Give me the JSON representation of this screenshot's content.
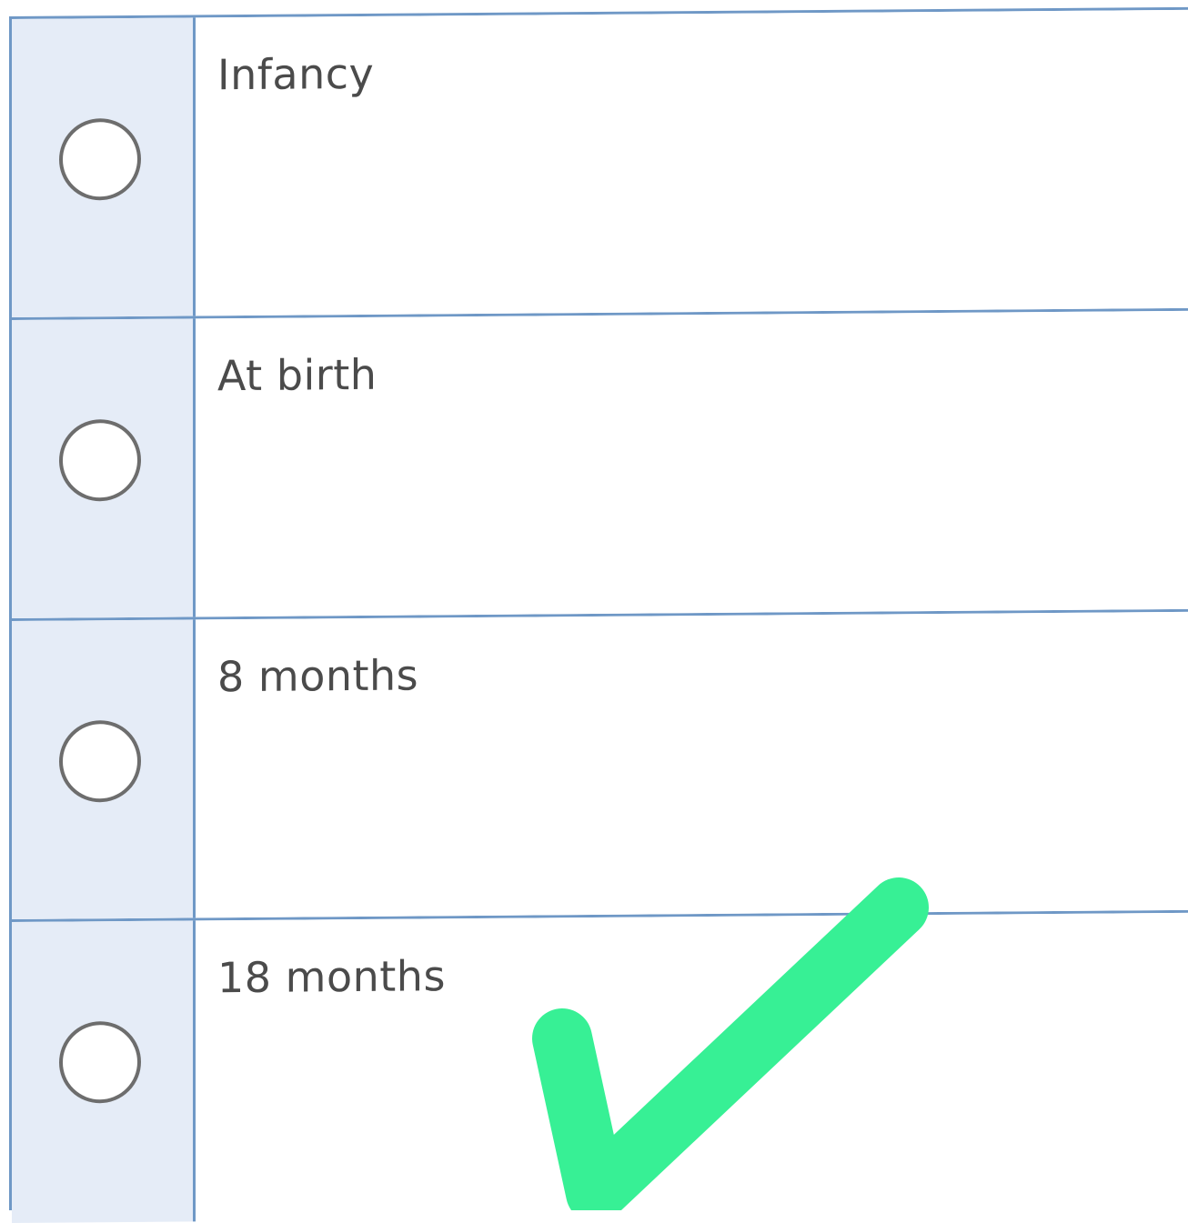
{
  "options": [
    {
      "label": "Infancy"
    },
    {
      "label": "At birth"
    },
    {
      "label": "8 months"
    },
    {
      "label": "18 months"
    }
  ],
  "colors": {
    "grid_line": "#6f98c6",
    "radio_column_bg": "#e5ecf7",
    "radio_border": "#6d6d6d",
    "label_text": "#4b4b4b",
    "checkmark": "#37f095"
  },
  "annotations": {
    "checkmark_icon": "checkmark-icon",
    "checkmark_marks_option": "18 months"
  }
}
